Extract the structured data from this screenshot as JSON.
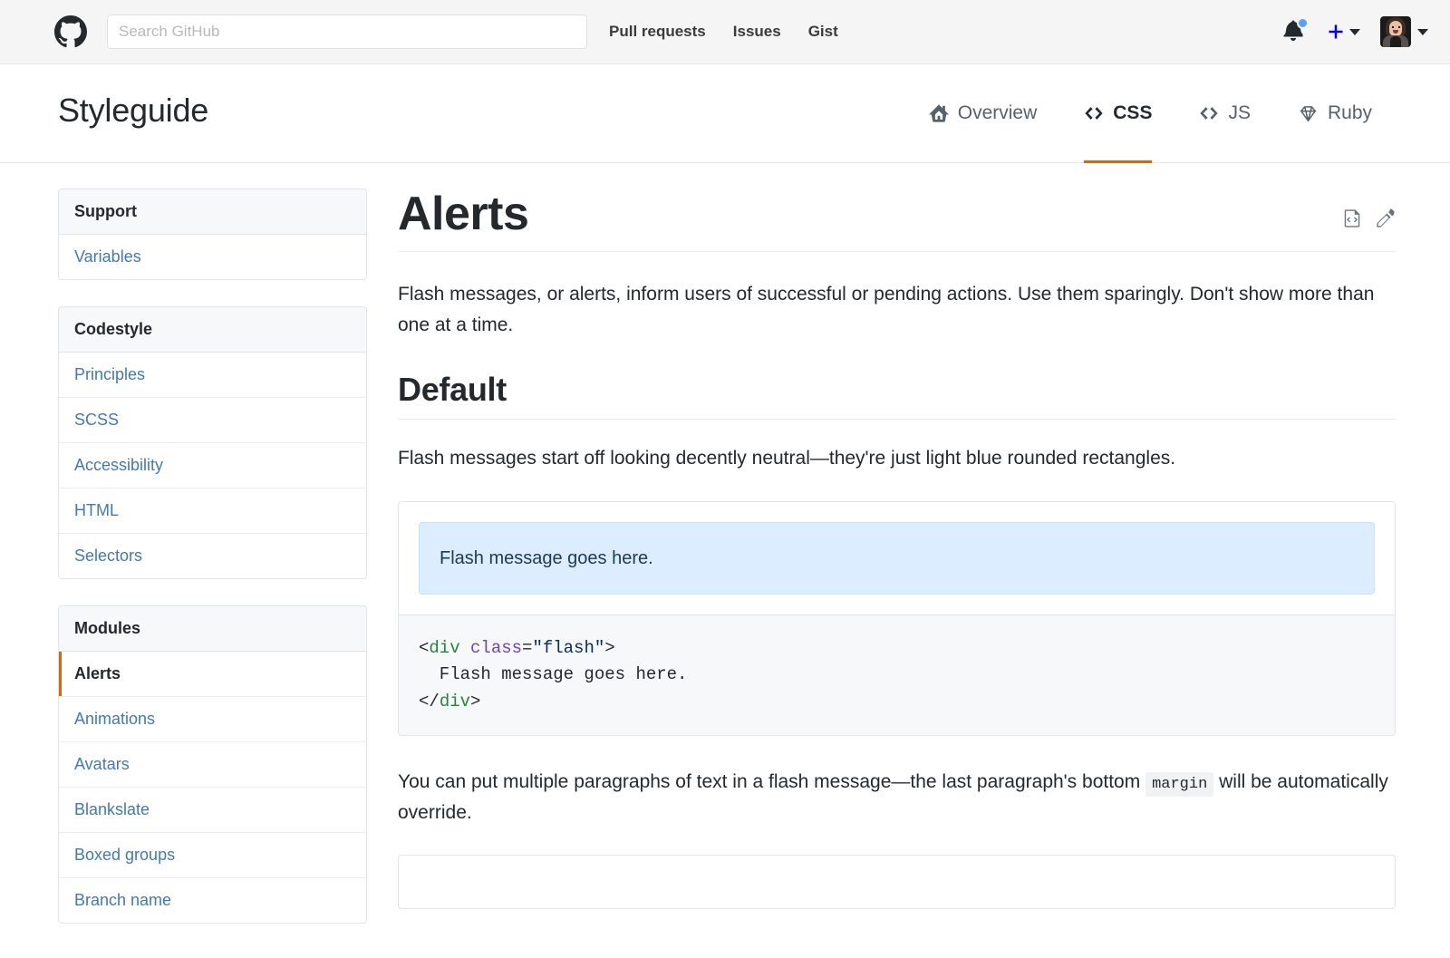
{
  "header": {
    "logo_icon": "github-mark-icon",
    "search": {
      "placeholder": "Search GitHub",
      "value": ""
    },
    "nav": [
      {
        "label": "Pull requests"
      },
      {
        "label": "Issues"
      },
      {
        "label": "Gist"
      }
    ],
    "notifications_icon": "bell-icon",
    "notifications_unread": true,
    "create_icon": "plus-icon",
    "create_caret_icon": "chevron-down-icon",
    "avatar_icon": "user-avatar",
    "avatar_caret_icon": "chevron-down-icon"
  },
  "page": {
    "title": "Styleguide",
    "tabs": [
      {
        "label": "Overview",
        "icon": "home-icon",
        "active": false
      },
      {
        "label": "CSS",
        "icon": "code-icon",
        "active": true
      },
      {
        "label": "JS",
        "icon": "code-icon",
        "active": false
      },
      {
        "label": "Ruby",
        "icon": "ruby-gem-icon",
        "active": false
      }
    ],
    "active_tab_color": "#d26911"
  },
  "sidebar": {
    "groups": [
      {
        "heading": "Support",
        "items": [
          {
            "label": "Variables",
            "selected": false
          }
        ]
      },
      {
        "heading": "Codestyle",
        "items": [
          {
            "label": "Principles",
            "selected": false
          },
          {
            "label": "SCSS",
            "selected": false
          },
          {
            "label": "Accessibility",
            "selected": false
          },
          {
            "label": "HTML",
            "selected": false
          },
          {
            "label": "Selectors",
            "selected": false
          }
        ]
      },
      {
        "heading": "Modules",
        "items": [
          {
            "label": "Alerts",
            "selected": true
          },
          {
            "label": "Animations",
            "selected": false
          },
          {
            "label": "Avatars",
            "selected": false
          },
          {
            "label": "Blankslate",
            "selected": false
          },
          {
            "label": "Boxed groups",
            "selected": false
          },
          {
            "label": "Branch name",
            "selected": false
          }
        ]
      }
    ],
    "link_color": "#4078c0",
    "selected_marker_color": "#d26911"
  },
  "doc": {
    "title": "Alerts",
    "actions": [
      {
        "icon": "file-code-icon",
        "name": "view-source"
      },
      {
        "icon": "pencil-icon",
        "name": "edit-page"
      }
    ],
    "intro": "Flash messages, or alerts, inform users of successful or pending actions. Use them sparingly. Don't show more than one at a time.",
    "sections": [
      {
        "heading": "Default",
        "paragraph": "Flash messages start off looking decently neutral—they're just light blue rounded rectangles.",
        "example": {
          "flash_text": "Flash message goes here.",
          "code_lines": [
            [
              {
                "t": "<",
                "c": "punc"
              },
              {
                "t": "div",
                "c": "tag"
              },
              {
                "t": " ",
                "c": "punc"
              },
              {
                "t": "class",
                "c": "attr"
              },
              {
                "t": "=",
                "c": "punc"
              },
              {
                "t": "\"flash\"",
                "c": "str"
              },
              {
                "t": ">",
                "c": "punc"
              }
            ],
            [
              {
                "t": "  Flash message goes here.",
                "c": "punc"
              }
            ],
            [
              {
                "t": "</",
                "c": "punc"
              },
              {
                "t": "div",
                "c": "tag"
              },
              {
                "t": ">",
                "c": "punc"
              }
            ]
          ]
        },
        "after_paragraph": {
          "before": "You can put multiple paragraphs of text in a flash message—the last paragraph's bottom ",
          "code": "margin",
          "after": " will be automatically override."
        }
      }
    ],
    "flash_colors": {
      "background": "#dbedff",
      "border": "#c8e1ff",
      "text": "#1b3a5c"
    }
  }
}
